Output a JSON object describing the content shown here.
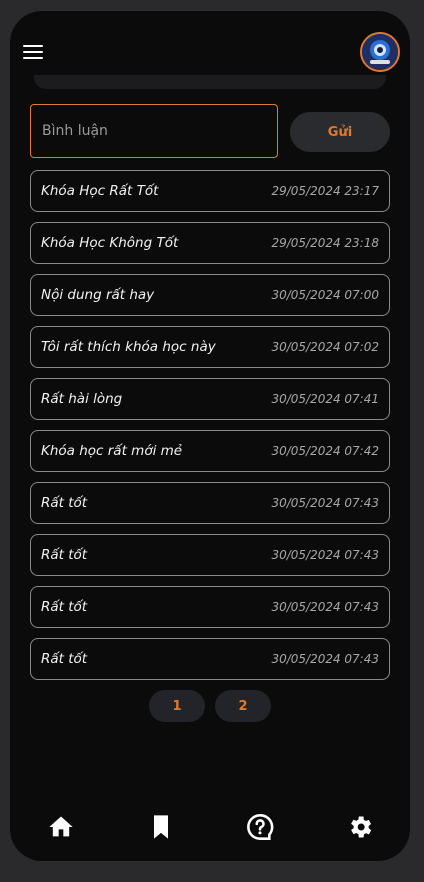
{
  "comment_form": {
    "placeholder": "Bình luận",
    "send_label": "Gửi"
  },
  "comments": [
    {
      "text": "Khóa Học Rất Tốt",
      "time": "29/05/2024 23:17"
    },
    {
      "text": "Khóa Học Không Tốt",
      "time": "29/05/2024 23:18"
    },
    {
      "text": "Nội dung rất hay",
      "time": "30/05/2024 07:00"
    },
    {
      "text": "Tôi rất thích khóa học này",
      "time": "30/05/2024 07:02"
    },
    {
      "text": "Rất hài lòng",
      "time": "30/05/2024 07:41"
    },
    {
      "text": "Khóa học rất mới mẻ",
      "time": "30/05/2024 07:42"
    },
    {
      "text": "Rất tốt",
      "time": "30/05/2024 07:43"
    },
    {
      "text": "Rất tốt",
      "time": "30/05/2024 07:43"
    },
    {
      "text": "Rất tốt",
      "time": "30/05/2024 07:43"
    },
    {
      "text": "Rất tốt",
      "time": "30/05/2024 07:43"
    }
  ],
  "pagination": {
    "pages": [
      "1",
      "2"
    ]
  },
  "colors": {
    "accent": "#e07a2e",
    "background": "#0b0b0c",
    "row_border": "#8a8a8a"
  },
  "icons": {
    "menu": "hamburger-menu-icon",
    "nav": [
      "home-icon",
      "bookmark-icon",
      "help-icon",
      "settings-icon"
    ]
  }
}
